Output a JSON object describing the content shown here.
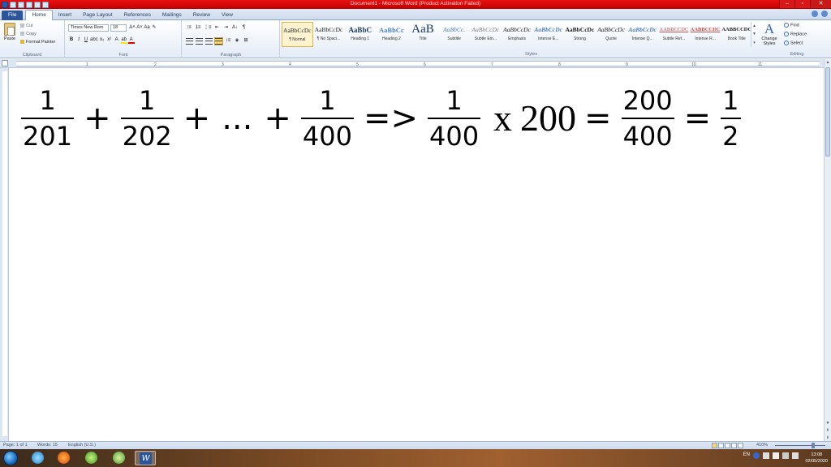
{
  "window": {
    "title": "Document1 - Microsoft Word (Product Activation Failed)"
  },
  "tabs": [
    "File",
    "Home",
    "Insert",
    "Page Layout",
    "References",
    "Mailings",
    "Review",
    "View"
  ],
  "ribbon": {
    "clipboard": {
      "paste": "Paste",
      "cut": "Cut",
      "copy": "Copy",
      "format_painter": "Format Painter",
      "group": "Clipboard"
    },
    "font": {
      "name": "Times New Rom",
      "size": "18",
      "group": "Font"
    },
    "paragraph": {
      "group": "Paragraph"
    },
    "styles": {
      "group": "Styles",
      "items": [
        {
          "sample": "AaBbCcDc",
          "name": "¶ Normal"
        },
        {
          "sample": "AaBbCcDc",
          "name": "¶ No Spaci..."
        },
        {
          "sample": "AaBbC",
          "name": "Heading 1"
        },
        {
          "sample": "AaBbCc",
          "name": "Heading 2"
        },
        {
          "sample": "AaB",
          "name": "Title"
        },
        {
          "sample": "AaBbCc.",
          "name": "Subtitle"
        },
        {
          "sample": "AaBbCcDc",
          "name": "Subtle Em..."
        },
        {
          "sample": "AaBbCcDc",
          "name": "Emphasis"
        },
        {
          "sample": "AaBbCcDc",
          "name": "Intense E..."
        },
        {
          "sample": "AaBbCcDc",
          "name": "Strong"
        },
        {
          "sample": "AaBbCcDc",
          "name": "Quote"
        },
        {
          "sample": "AaBbCcDc",
          "name": "Intense Q..."
        },
        {
          "sample": "AABBCCDC",
          "name": "Subtle Ref..."
        },
        {
          "sample": "AABBCCDC",
          "name": "Intense R..."
        },
        {
          "sample": "AABBCCDC",
          "name": "Book Title"
        }
      ],
      "change_styles": "Change Styles"
    },
    "editing": {
      "group": "Editing",
      "find": "Find",
      "replace": "Replace",
      "select": "Select"
    }
  },
  "ruler": {
    "numbers": [
      "1",
      "2",
      "3",
      "4",
      "5",
      "6",
      "7",
      "8",
      "9",
      "10",
      "11"
    ]
  },
  "document": {
    "fractions": [
      {
        "num": "1",
        "den": "201"
      },
      {
        "num": "1",
        "den": "202"
      },
      {
        "num": "1",
        "den": "400"
      },
      {
        "num": "1",
        "den": "400"
      },
      {
        "num": "200",
        "den": "400"
      },
      {
        "num": "1",
        "den": "2"
      }
    ],
    "plus": "+",
    "ellipsis": "...",
    "implies": "=>",
    "times": "x",
    "multiplier": "200",
    "equals": "="
  },
  "status": {
    "page": "Page: 1 of 1",
    "words": "Words: 15",
    "language": "English (U.S.)",
    "zoom": "410%"
  },
  "taskbar": {
    "language": "EN",
    "time": "13:08",
    "date": "02/05/2020"
  },
  "colors": {
    "title_bar": "#d41010",
    "file_tab": "#2b579a",
    "ribbon_bg": "#e4ecf7"
  }
}
